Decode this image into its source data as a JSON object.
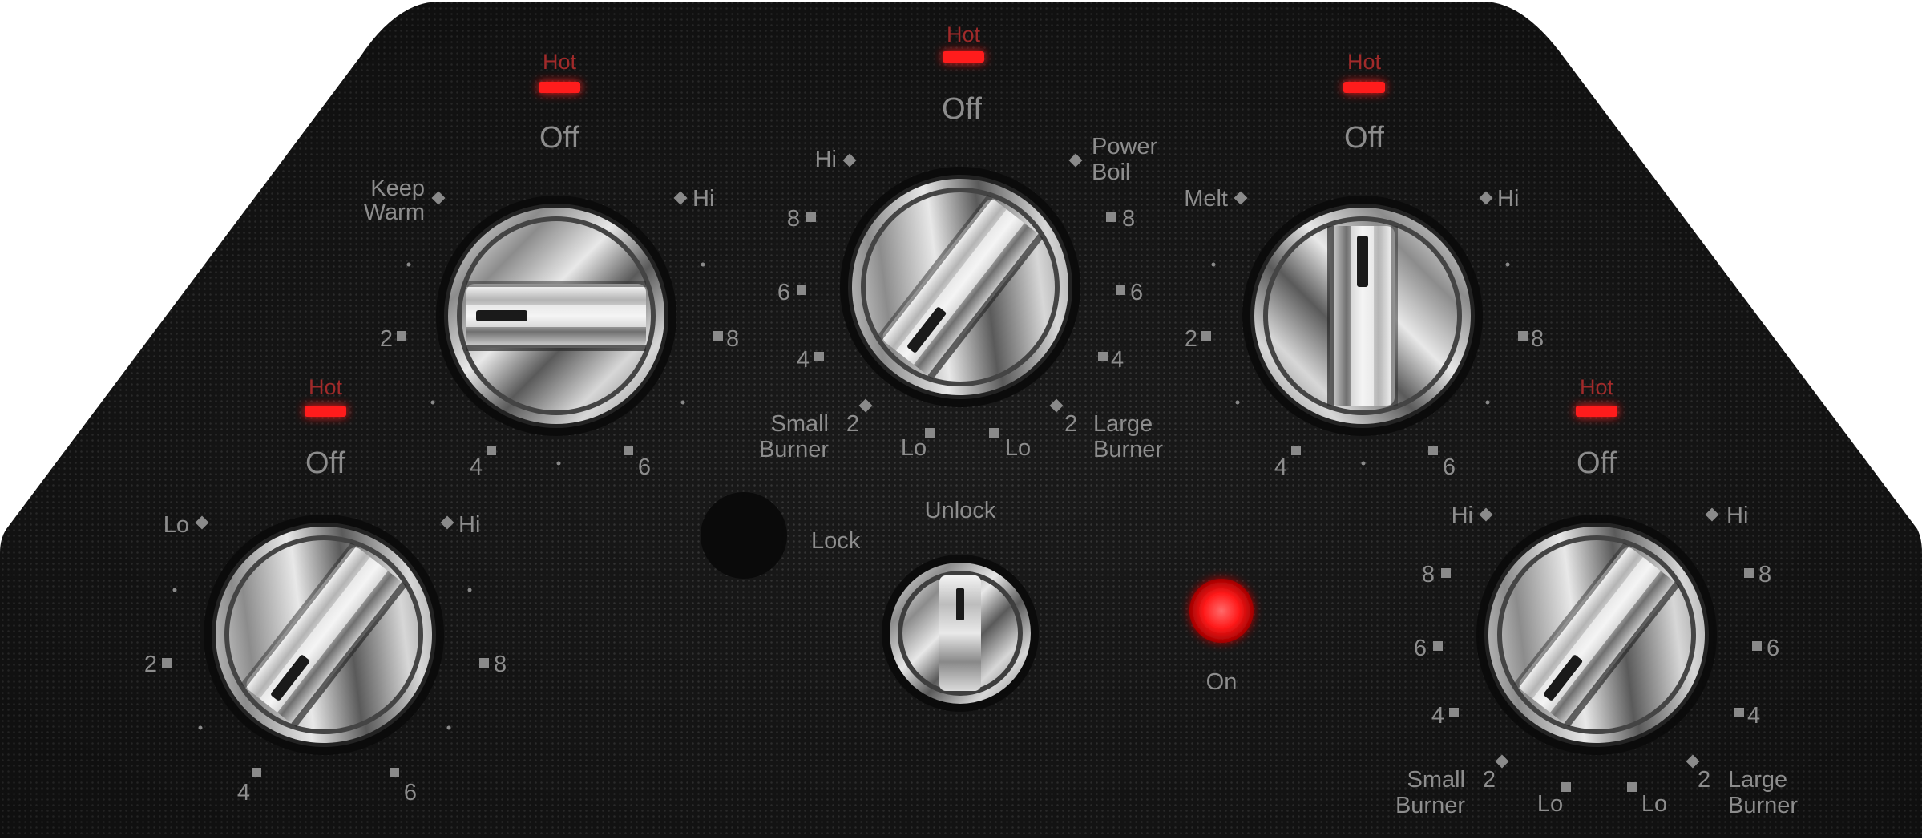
{
  "panel": {
    "colors": {
      "surface": "#1b1b1b",
      "indicator_red": "#ff1a1a",
      "label_gray": "#8f8f8f",
      "hot_label": "#a02a2a"
    }
  },
  "indicators": {
    "hot_label": "Hot",
    "off_label": "Off"
  },
  "knobs": {
    "left_rear": {
      "icon": "rotary-knob-icon",
      "labels": {
        "keep": "Keep",
        "warm": "Warm",
        "hi": "Hi",
        "two": "2",
        "eight": "8",
        "four": "4",
        "six": "6"
      }
    },
    "center_rear": {
      "icon": "rotary-knob-icon",
      "labels": {
        "hi": "Hi",
        "power": "Power",
        "boil": "Boil",
        "eight_l": "8",
        "eight_r": "8",
        "six_l": "6",
        "six_r": "6",
        "four_l": "4",
        "four_r": "4",
        "small": "Small",
        "burner_l": "Burner",
        "two_l": "2",
        "lo_l": "Lo",
        "lo_r": "Lo",
        "two_r": "2",
        "large": "Large",
        "burner_r": "Burner"
      }
    },
    "right_rear": {
      "icon": "rotary-knob-icon",
      "labels": {
        "melt": "Melt",
        "hi": "Hi",
        "two": "2",
        "eight": "8",
        "four": "4",
        "six": "6"
      }
    },
    "left_front": {
      "icon": "rotary-knob-icon",
      "labels": {
        "lo": "Lo",
        "hi": "Hi",
        "two": "2",
        "eight": "8",
        "four": "4",
        "six": "6"
      }
    },
    "right_front": {
      "icon": "rotary-knob-icon",
      "labels": {
        "hi_l": "Hi",
        "hi_r": "Hi",
        "eight_l": "8",
        "eight_r": "8",
        "six_l": "6",
        "six_r": "6",
        "four_l": "4",
        "four_r": "4",
        "small": "Small",
        "burner_l": "Burner",
        "two_l": "2",
        "lo_l": "Lo",
        "lo_r": "Lo",
        "two_r": "2",
        "large": "Large",
        "burner_r": "Burner"
      }
    }
  },
  "lock": {
    "unlock_label": "Unlock",
    "lock_label": "Lock",
    "on_label": "On",
    "icon": "lock-button-icon"
  }
}
